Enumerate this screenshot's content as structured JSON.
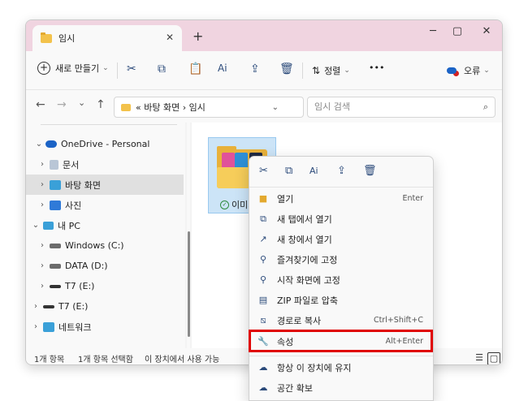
{
  "window": {
    "tab_title": "임시",
    "tab_close": "✕",
    "new_tab": "+",
    "minimize": "─",
    "maximize": "▢",
    "close": "✕"
  },
  "toolbar": {
    "new_label": "새로 만들기",
    "sort_label": "정렬",
    "more": "•••",
    "account_label": "오류",
    "icons": [
      "cut-icon",
      "copy-icon",
      "paste-icon",
      "rename-icon",
      "share-icon",
      "delete-icon"
    ]
  },
  "address": {
    "back": "←",
    "forward": "→",
    "recent": "⌄",
    "up": "↑",
    "path": "« 바탕 화면 › 임시",
    "refresh": "↻",
    "search_placeholder": "임시 검색"
  },
  "sidebar": {
    "items": [
      {
        "label": "OneDrive - Personal",
        "chev": "⌄"
      },
      {
        "label": "문서",
        "chev": "›"
      },
      {
        "label": "바탕 화면",
        "chev": "›"
      },
      {
        "label": "사진",
        "chev": "›"
      },
      {
        "label": "내 PC",
        "chev": "⌄"
      },
      {
        "label": "Windows (C:)",
        "chev": "›"
      },
      {
        "label": "DATA (D:)",
        "chev": "›"
      },
      {
        "label": "T7 (E:)",
        "chev": "›"
      },
      {
        "label": "T7 (E:)",
        "chev": "›"
      },
      {
        "label": "네트워크",
        "chev": "›"
      }
    ]
  },
  "content": {
    "file_name": "이미지"
  },
  "status": {
    "count": "1개 항목",
    "selected": "1개 항목 선택함",
    "availability": "이 장치에서 사용 가능"
  },
  "context_menu": {
    "items": [
      {
        "label": "열기",
        "shortcut": "Enter",
        "icon": "folder-icon"
      },
      {
        "label": "새 탭에서 열기",
        "shortcut": "",
        "icon": "new-tab-icon"
      },
      {
        "label": "새 창에서 열기",
        "shortcut": "",
        "icon": "new-window-icon"
      },
      {
        "label": "즐겨찾기에 고정",
        "shortcut": "",
        "icon": "pin-icon"
      },
      {
        "label": "시작 화면에 고정",
        "shortcut": "",
        "icon": "pin-icon"
      },
      {
        "label": "ZIP 파일로 압축",
        "shortcut": "",
        "icon": "zip-icon"
      },
      {
        "label": "경로로 복사",
        "shortcut": "Ctrl+Shift+C",
        "icon": "copy-path-icon"
      },
      {
        "label": "속성",
        "shortcut": "Alt+Enter",
        "icon": "wrench-icon"
      },
      {
        "label": "항상 이 장치에 유지",
        "shortcut": "",
        "icon": "onedrive-keep-icon"
      },
      {
        "label": "공간 확보",
        "shortcut": "",
        "icon": "cloud-icon"
      }
    ]
  },
  "colors": {
    "title_bg": "#f0d4e0",
    "highlight": "#e00000",
    "selection": "#cce4f7"
  }
}
